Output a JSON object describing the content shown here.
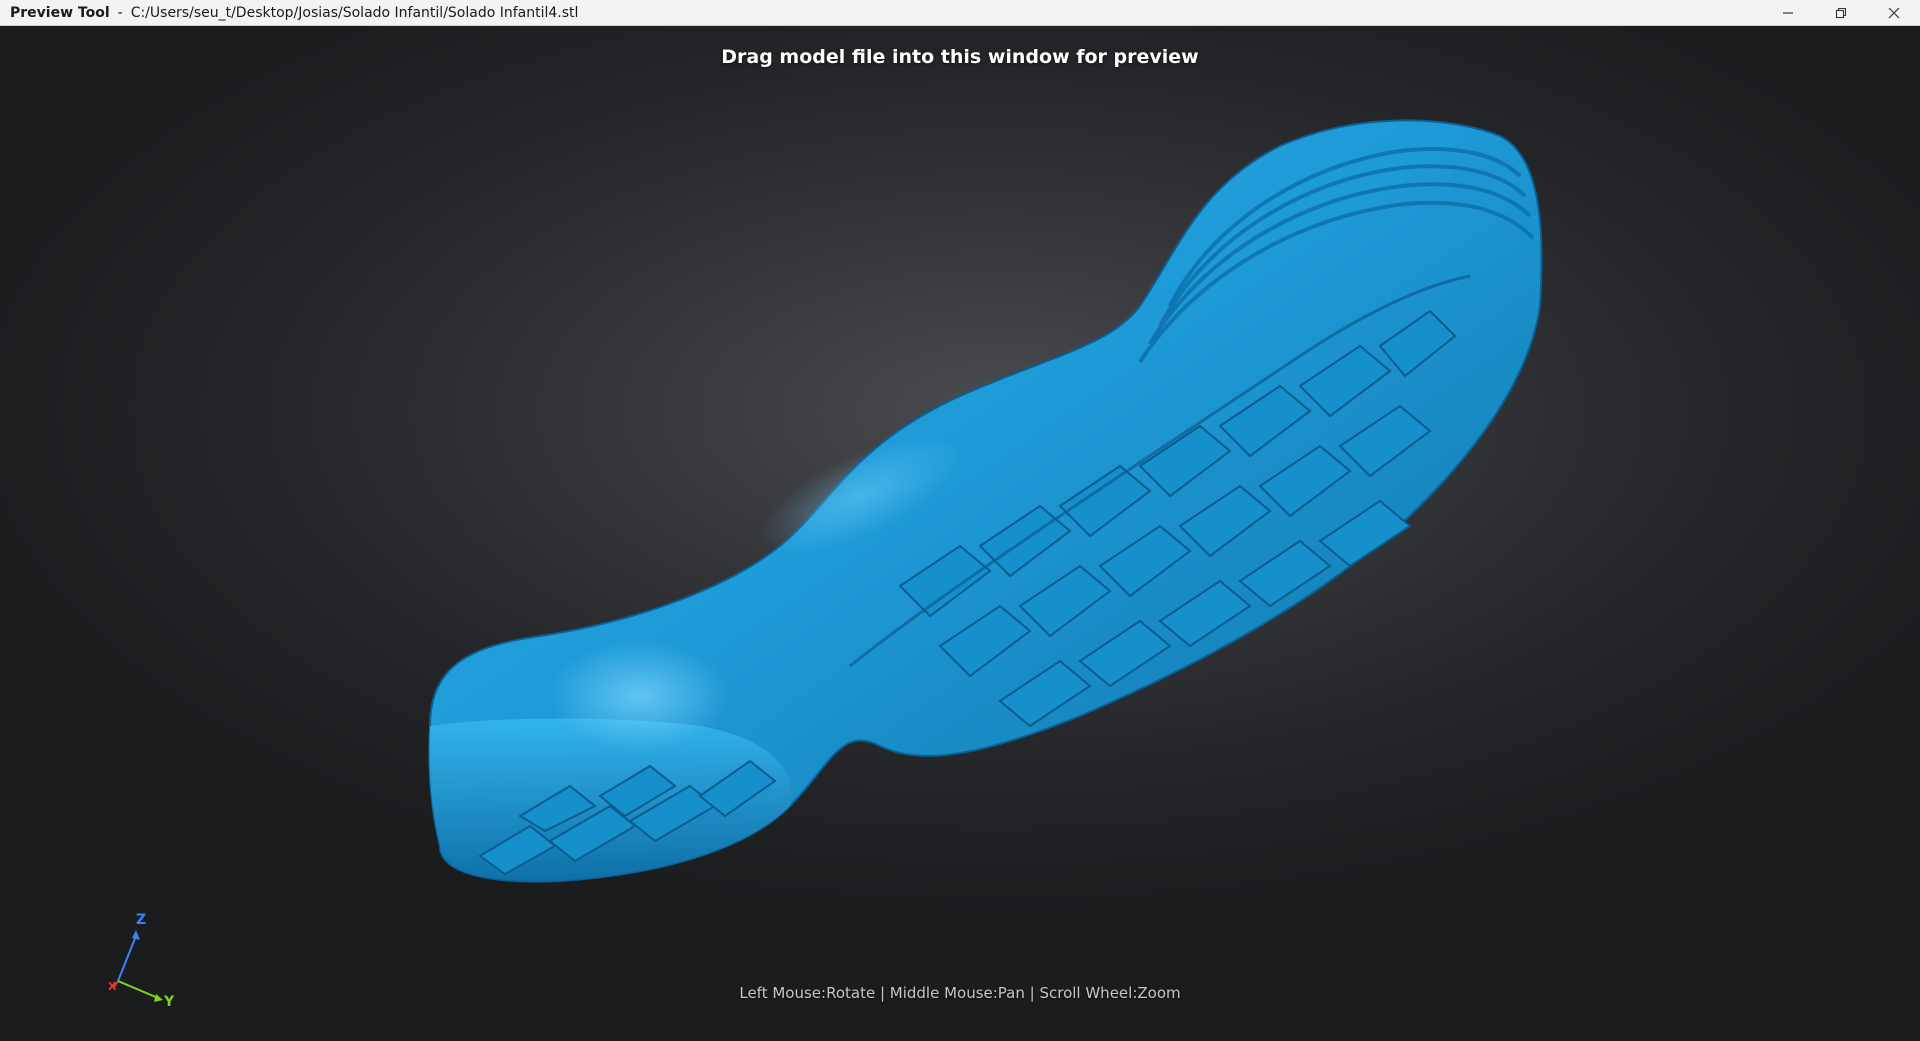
{
  "window": {
    "app_name": "Preview Tool",
    "separator": "-",
    "file_path": "C:/Users/seu_t/Desktop/Josias/Solado Infantil/Solado Infantil4.stl",
    "controls": {
      "minimize_icon": "minimize-icon",
      "restore_icon": "restore-icon",
      "close_icon": "close-icon"
    }
  },
  "viewport": {
    "drop_hint": "Drag model file into this window for preview",
    "controls_hint": "Left Mouse:Rotate | Middle Mouse:Pan | Scroll Wheel:Zoom",
    "background_color": "#2a2b2e",
    "model_color": "#1e9bd7"
  },
  "axis_gizmo": {
    "z_label": "Z",
    "y_label": "Y",
    "x_label": "X",
    "z_color": "#3b82f6",
    "y_color": "#7ed321",
    "x_color": "#e53935"
  }
}
